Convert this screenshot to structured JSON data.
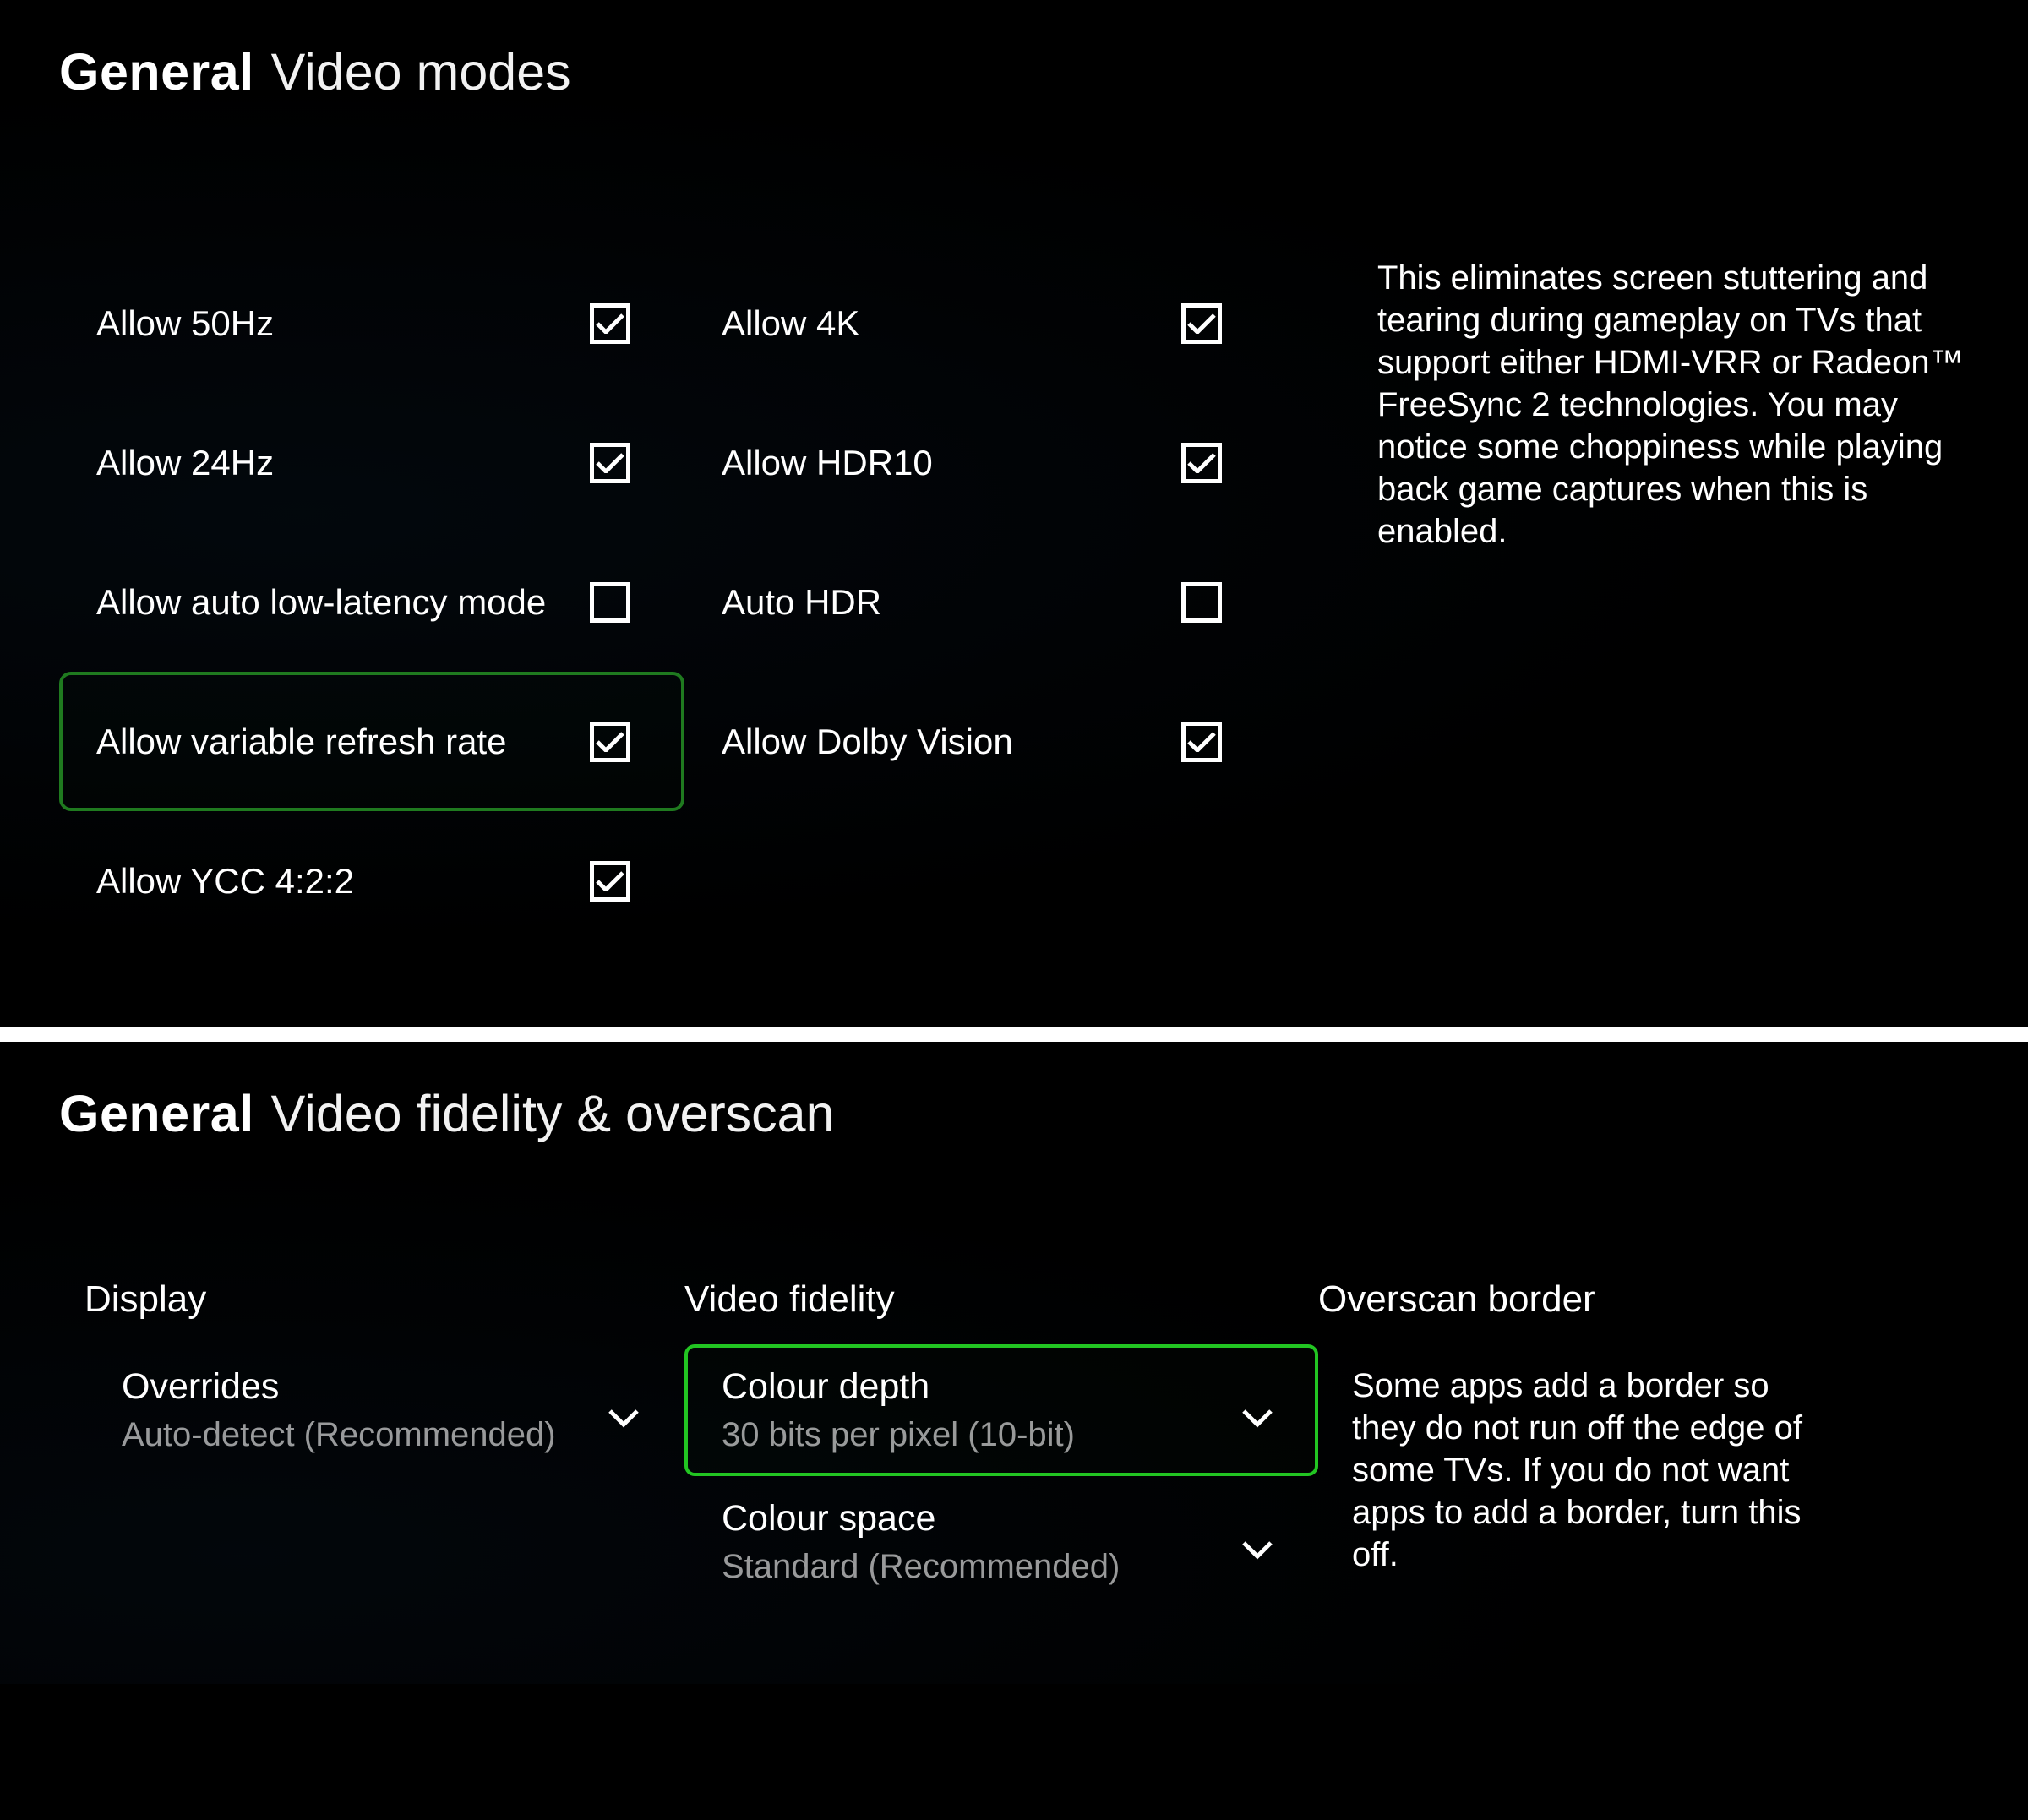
{
  "panel1": {
    "crumb": "General",
    "title": "Video modes",
    "col1": [
      {
        "label": "Allow 50Hz",
        "checked": true,
        "selected": false
      },
      {
        "label": "Allow 24Hz",
        "checked": true,
        "selected": false
      },
      {
        "label": "Allow auto low-latency mode",
        "checked": false,
        "selected": false
      },
      {
        "label": "Allow variable refresh rate",
        "checked": true,
        "selected": true
      },
      {
        "label": "Allow YCC 4:2:2",
        "checked": true,
        "selected": false
      }
    ],
    "col2": [
      {
        "label": "Allow 4K",
        "checked": true,
        "selected": false
      },
      {
        "label": "Allow HDR10",
        "checked": true,
        "selected": false
      },
      {
        "label": "Auto HDR",
        "checked": false,
        "selected": false
      },
      {
        "label": "Allow Dolby Vision",
        "checked": true,
        "selected": false
      }
    ],
    "info": "This eliminates screen stuttering and tearing during gameplay on TVs that support either HDMI-VRR or Radeon™ FreeSync 2 technologies. You may notice some choppiness while playing back game captures when this is enabled."
  },
  "panel2": {
    "crumb": "General",
    "title": "Video fidelity & overscan",
    "display": {
      "section": "Display",
      "drop": {
        "label": "Overrides",
        "value": "Auto-detect (Recommended)",
        "selected": false
      }
    },
    "fidelity": {
      "section": "Video fidelity",
      "drops": [
        {
          "label": "Colour depth",
          "value": "30 bits per pixel (10-bit)",
          "selected": true
        },
        {
          "label": "Colour space",
          "value": "Standard (Recommended)",
          "selected": false
        }
      ]
    },
    "overscan": {
      "section": "Overscan border",
      "text": "Some apps add a border so they do not run off the edge of some TVs. If you do not want apps to add a border, turn this off."
    }
  }
}
